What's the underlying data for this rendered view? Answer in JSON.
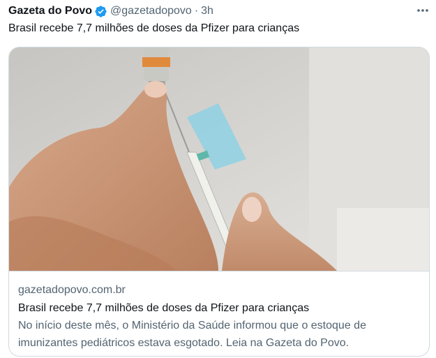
{
  "tweet": {
    "author_name": "Gazeta do Povo",
    "handle": "@gazetadopovo",
    "separator": "·",
    "time": "3h",
    "text": "Brasil recebe 7,7 milhões de doses da Pfizer para crianças",
    "icons": {
      "verified": "verified-badge-icon",
      "more": "more-options-icon"
    },
    "colors": {
      "verified": "#1d9bf0",
      "secondary_text": "#536471",
      "border": "#cfd9de"
    }
  },
  "card": {
    "image_description_icon": "vaccine-syringe-photo",
    "domain": "gazetadopovo.com.br",
    "title": "Brasil recebe 7,7 milhões de doses da Pfizer para crianças",
    "description": "No início deste mês, o Ministério da Saúde informou que o estoque de imunizantes pediátricos estava esgotado. Leia na Gazeta do Povo."
  }
}
